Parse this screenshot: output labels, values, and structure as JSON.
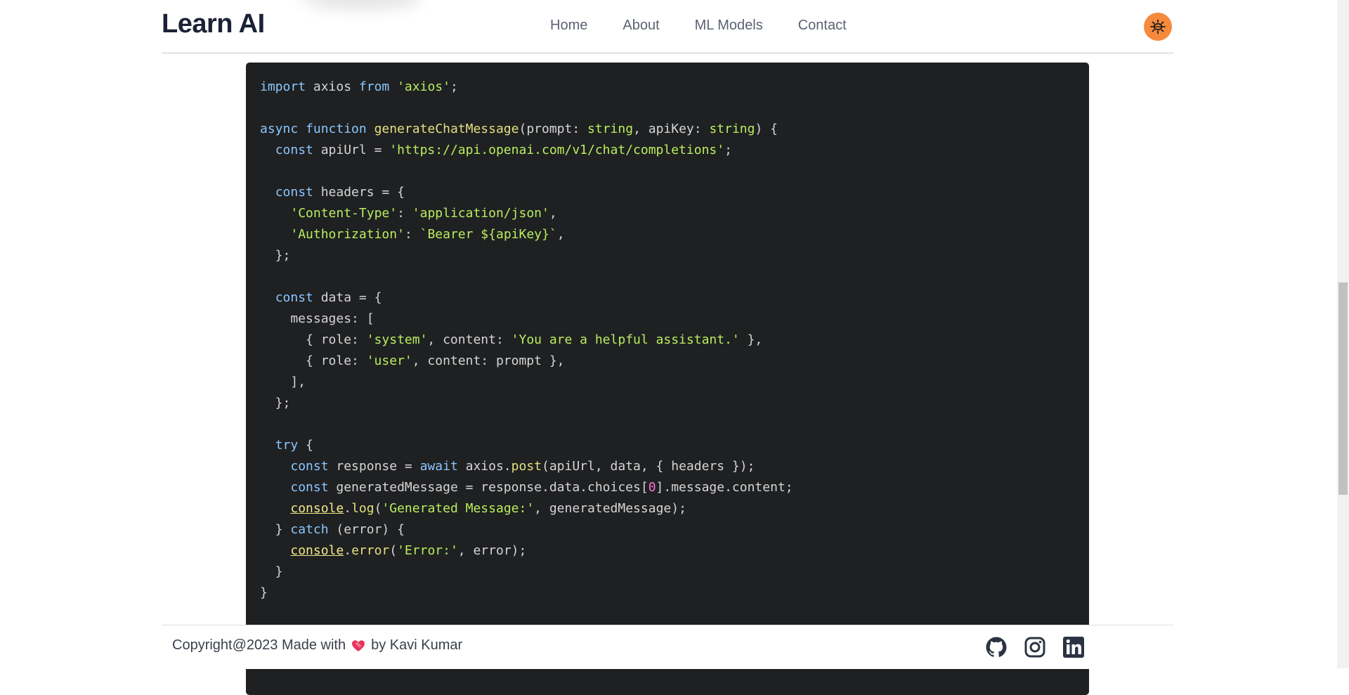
{
  "header": {
    "logo": "Learn AI",
    "nav": [
      "Home",
      "About",
      "ML Models",
      "Contact"
    ]
  },
  "code": {
    "language": "typescript",
    "lines": [
      "import axios from 'axios';",
      "",
      "async function generateChatMessage(prompt: string, apiKey: string) {",
      "  const apiUrl = 'https://api.openai.com/v1/chat/completions';",
      "",
      "  const headers = {",
      "    'Content-Type': 'application/json',",
      "    'Authorization': `Bearer ${apiKey}`,",
      "  };",
      "",
      "  const data = {",
      "    messages: [",
      "      { role: 'system', content: 'You are a helpful assistant.' },",
      "      { role: 'user', content: prompt },",
      "    ],",
      "  };",
      "",
      "  try {",
      "    const response = await axios.post(apiUrl, data, { headers });",
      "    const generatedMessage = response.data.choices[0].message.content;",
      "    console.log('Generated Message:', generatedMessage);",
      "  } catch (error) {",
      "    console.error('Error:', error);",
      "  }",
      "}"
    ]
  },
  "footer": {
    "copyright_prefix": "Copyright@2023 Made with",
    "copyright_suffix": "by Kavi Kumar",
    "social_icons": [
      "github-icon",
      "instagram-icon",
      "linkedin-icon"
    ]
  },
  "colors": {
    "code_background": "#1f2022",
    "keyword": "#8ac7ff",
    "string": "#b8ee5e",
    "function": "#e2e07e",
    "number": "#ff6fd1",
    "theme_toggle": "#f58a3c",
    "heart": "#e8345c"
  }
}
